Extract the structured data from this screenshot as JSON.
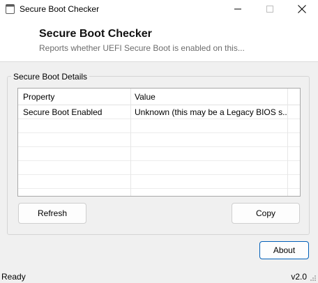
{
  "window": {
    "title": "Secure Boot Checker",
    "icons": {
      "app": "app-window-icon",
      "minimize": "minimize-icon",
      "maximize": "maximize-icon",
      "close": "close-icon"
    }
  },
  "header": {
    "title": "Secure Boot Checker",
    "subtitle": "Reports whether UEFI Secure Boot is enabled on this..."
  },
  "details": {
    "group_label": "Secure Boot Details",
    "columns": [
      "Property",
      "Value"
    ],
    "rows": [
      {
        "property": "Secure Boot Enabled",
        "value": "Unknown (this may be a Legacy BIOS s..."
      }
    ]
  },
  "buttons": {
    "refresh": "Refresh",
    "copy": "Copy",
    "about": "About"
  },
  "status": {
    "text": "Ready",
    "version": "v2.0"
  }
}
